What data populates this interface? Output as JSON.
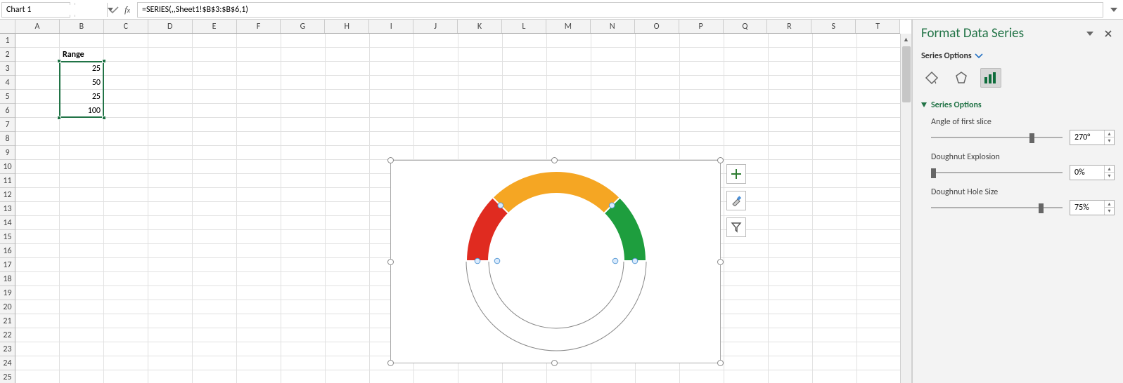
{
  "name_box": "Chart 1",
  "formula": "=SERIES(,,Sheet1!$B$3:$B$6,1)",
  "columns": [
    "A",
    "B",
    "C",
    "D",
    "E",
    "F",
    "G",
    "H",
    "I",
    "J",
    "K",
    "L",
    "M",
    "N",
    "O",
    "P",
    "Q",
    "R",
    "S",
    "T"
  ],
  "rows_visible": 25,
  "sheet": {
    "B2": "Range",
    "B3": "25",
    "B4": "50",
    "B5": "25",
    "B6": "100"
  },
  "chart_data": {
    "type": "pie",
    "subtype": "doughnut",
    "series_formula": "=SERIES(,,Sheet1!$B$3:$B$6,1)",
    "values": [
      25,
      50,
      25,
      100
    ],
    "angle_first_slice_deg": 270,
    "hole_pct": 75,
    "explosion_pct": 0,
    "colors": [
      "#E02B20",
      "#F5A623",
      "#1E9E3E",
      "#FFFFFF"
    ],
    "last_slice_border_only": true,
    "title": "",
    "legend": false
  },
  "chart_tools": [
    "plus-icon",
    "brush-icon",
    "funnel-icon"
  ],
  "pane": {
    "title": "Format Data Series",
    "subtitle": "Series Options",
    "tabs": [
      "fill-icon",
      "effects-icon",
      "series-options-icon"
    ],
    "active_tab": 2,
    "section_title": "Series Options",
    "options": {
      "angle_label": "Angle of first slice",
      "angle_value": "270°",
      "angle_pct": 75,
      "explosion_label": "Doughnut Explosion",
      "explosion_value": "0%",
      "explosion_pct": 0,
      "hole_label": "Doughnut Hole Size",
      "hole_value": "75%",
      "hole_pct": 82
    }
  }
}
